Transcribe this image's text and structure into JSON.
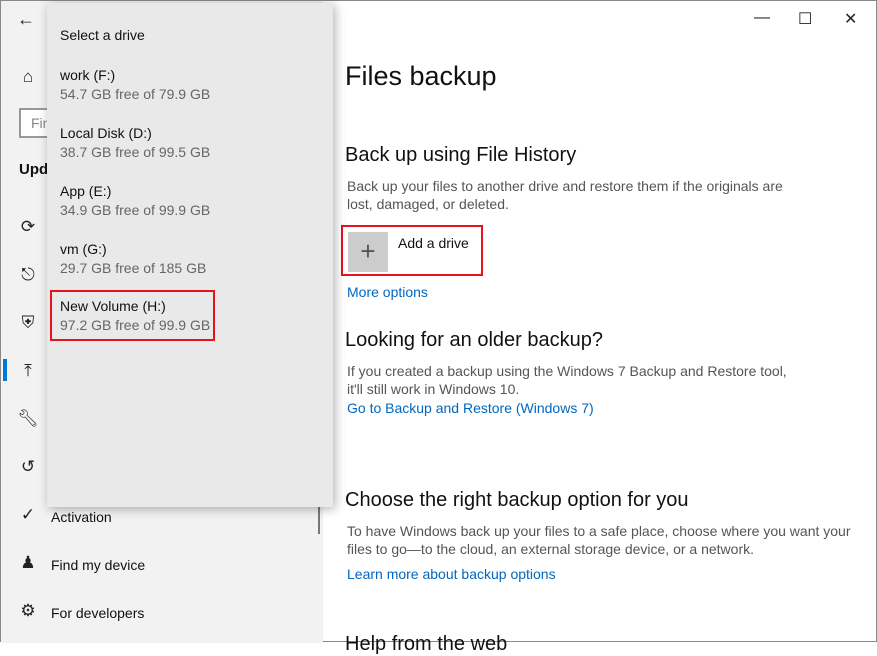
{
  "sidebar": {
    "search_placeholder": "Find a setting",
    "section": "Update & Security",
    "items": [
      {
        "icon": "activation-icon",
        "label": "Activation"
      },
      {
        "icon": "find-my-device-icon",
        "label": "Find my device"
      },
      {
        "icon": "developers-icon",
        "label": "For developers"
      }
    ]
  },
  "flyout": {
    "title": "Select a drive",
    "drives": [
      {
        "name": "work (F:)",
        "free": "54.7 GB free of 79.9 GB"
      },
      {
        "name": "Local Disk (D:)",
        "free": "38.7 GB free of 99.5 GB"
      },
      {
        "name": "App (E:)",
        "free": "34.9 GB free of 99.9 GB"
      },
      {
        "name": "vm (G:)",
        "free": "29.7 GB free of 185 GB"
      },
      {
        "name": "New Volume (H:)",
        "free": "97.2 GB free of 99.9 GB",
        "highlighted": true
      }
    ]
  },
  "main": {
    "title": "Files backup",
    "s1": {
      "heading": "Back up using File History",
      "text": "Back up your files to another drive and restore them if the originals are lost, damaged, or deleted.",
      "add": "Add a drive",
      "more": "More options"
    },
    "s2": {
      "heading": "Looking for an older backup?",
      "text": "If you created a backup using the Windows 7 Backup and Restore tool, it'll still work in Windows 10.",
      "link": "Go to Backup and Restore (Windows 7)"
    },
    "s3": {
      "heading": "Choose the right backup option for you",
      "text": "To have Windows back up your files to a safe place, choose where you want your files to go—to the cloud, an external storage device, or a network.",
      "link": "Learn more about backup options"
    },
    "s4": {
      "heading": "Help from the web"
    }
  },
  "colors": {
    "accent": "#0078d7",
    "link": "#0067c0",
    "highlight": "#e8121a"
  }
}
